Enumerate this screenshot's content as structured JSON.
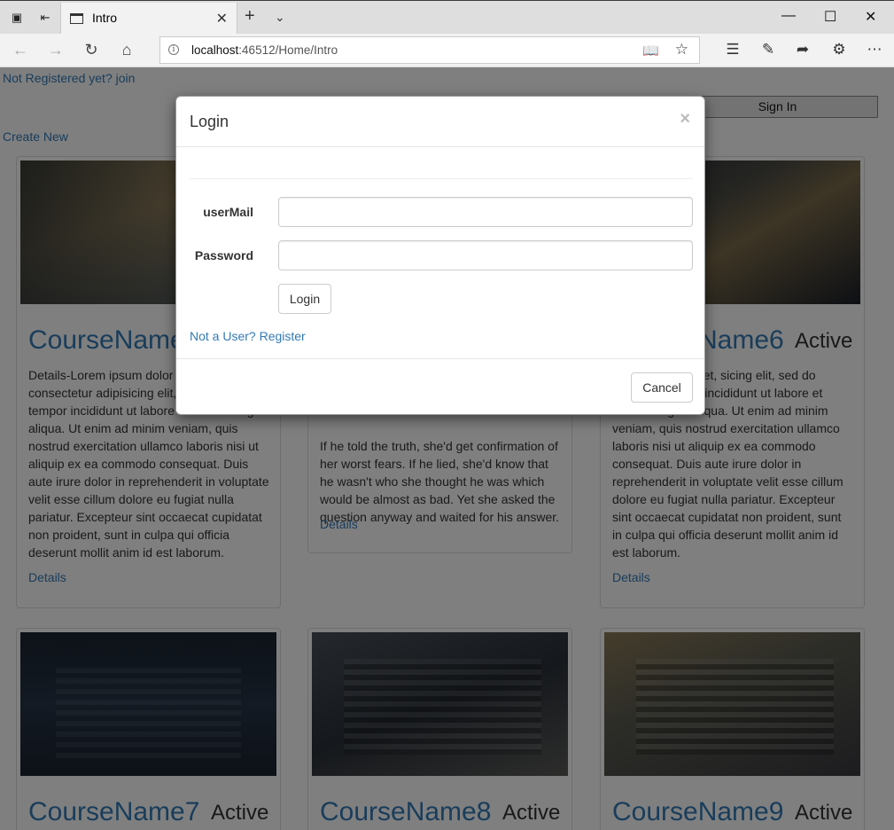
{
  "browser": {
    "tab_title": "Intro",
    "url_host": "localhost",
    "url_path": ":46512/Home/Intro"
  },
  "page": {
    "not_registered_link": "Not Registered yet? join",
    "sign_in_button": "Sign In",
    "create_new_link": "Create New"
  },
  "cards": [
    {
      "title": "CourseName",
      "status": "",
      "description": "Details-Lorem ipsum dolor sit amet, consectetur adipisicing elit, sed do eiusmod tempor incididunt ut labore et dolore magna aliqua. Ut enim ad minim veniam, quis nostrud exercitation ullamco laboris nisi ut aliquip ex ea commodo consequat. Duis aute irure dolor in reprehenderit in voluptate velit esse cillum dolore eu fugiat nulla pariatur. Excepteur sint occaecat cupidatat non proident, sunt in culpa qui officia deserunt mollit anim id est laborum.",
      "details": "Details"
    },
    {
      "title": "",
      "status": "",
      "description": "If he told the truth, she'd get confirmation of her worst fears. If he lied, she'd know that he wasn't who she thought he was which would be almost as bad. Yet she asked the question anyway and waited for his answer.",
      "details": "Details"
    },
    {
      "title": "Name6",
      "status": "Active",
      "description": "sum dolor sit amet, sicing elit, sed do eiusmod tempor incididunt ut labore et dolore magna aliqua. Ut enim ad minim veniam, quis nostrud exercitation ullamco laboris nisi ut aliquip ex ea commodo consequat. Duis aute irure dolor in reprehenderit in voluptate velit esse cillum dolore eu fugiat nulla pariatur. Excepteur sint occaecat cupidatat non proident, sunt in culpa qui officia deserunt mollit anim id est laborum.",
      "details": "Details"
    },
    {
      "title": "CourseName7",
      "status": "Active"
    },
    {
      "title": "CourseName8",
      "status": "Active"
    },
    {
      "title": "CourseName9",
      "status": "Active"
    }
  ],
  "modal": {
    "title": "Login",
    "close_symbol": "×",
    "usermail_label": "userMail",
    "password_label": "Password",
    "usermail_value": "",
    "password_value": "",
    "login_button": "Login",
    "register_link": "Not a User? Register",
    "cancel_button": "Cancel"
  }
}
